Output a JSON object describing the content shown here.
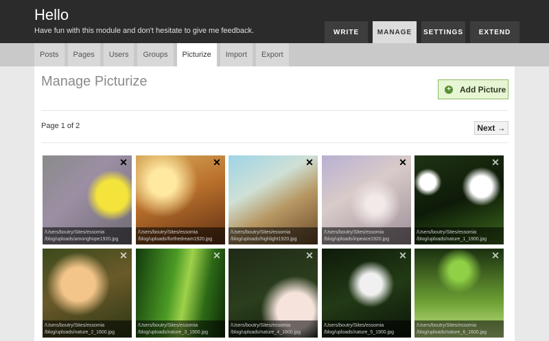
{
  "header": {
    "title": "Hello",
    "subtitle": "Have fun with this module and don't hesitate to give me feedback."
  },
  "main_nav": {
    "items": [
      {
        "label": "WRITE",
        "active": false
      },
      {
        "label": "MANAGE",
        "active": true
      },
      {
        "label": "SETTINGS",
        "active": false
      },
      {
        "label": "EXTEND",
        "active": false
      }
    ]
  },
  "sub_nav": {
    "tabs": [
      {
        "label": "Posts",
        "active": false
      },
      {
        "label": "Pages",
        "active": false
      },
      {
        "label": "Users",
        "active": false
      },
      {
        "label": "Groups",
        "active": false
      },
      {
        "label": "Picturize",
        "active": true
      },
      {
        "label": "Import",
        "active": false
      },
      {
        "label": "Export",
        "active": false
      }
    ]
  },
  "main": {
    "page_title": "Manage Picturize",
    "add_button": {
      "label": "Add Picture",
      "icon": "plus-circle-icon"
    },
    "pager": {
      "text": "Page 1 of 2",
      "next_label": "Next →"
    },
    "pictures": [
      {
        "path": "/Users/boutry/Sites/essomia\n/blog/uploads/amonghope1920.jpg",
        "close_icon": "close-icon"
      },
      {
        "path": "/Users/boutry/Sites/essomia\n/blog/uploads/forthedream1920.jpg",
        "close_icon": "close-icon"
      },
      {
        "path": "/Users/boutry/Sites/essomia\n/blog/uploads/highlight1920.jpg",
        "close_icon": "close-icon"
      },
      {
        "path": "/Users/boutry/Sites/essomia\n/blog/uploads/inpeace1920.jpg",
        "close_icon": "close-icon"
      },
      {
        "path": "/Users/boutry/Sites/essomia\n/blog/uploads/nature_1_1900.jpg",
        "close_icon": "close-icon"
      },
      {
        "path": "/Users/boutry/Sites/essomia\n/blog/uploads/nature_2_1600.jpg",
        "close_icon": "close-icon"
      },
      {
        "path": "/Users/boutry/Sites/essomia\n/blog/uploads/nature_3_1900.jpg",
        "close_icon": "close-icon"
      },
      {
        "path": "/Users/boutry/Sites/essomia\n/blog/uploads/nature_4_1600.jpg",
        "close_icon": "close-icon"
      },
      {
        "path": "/Users/boutry/Sites/essomia\n/blog/uploads/nature_5_1900.jpg",
        "close_icon": "close-icon"
      },
      {
        "path": "/Users/boutry/Sites/essomia\n/blog/uploads/nature_6_1600.jpg",
        "close_icon": "close-icon"
      }
    ]
  },
  "colors": {
    "header_bg": "#2b2b2b",
    "subnav_bg": "#c9c9c9",
    "add_button_bg": "#e6f5d3",
    "add_button_border": "#8bbb5e"
  }
}
